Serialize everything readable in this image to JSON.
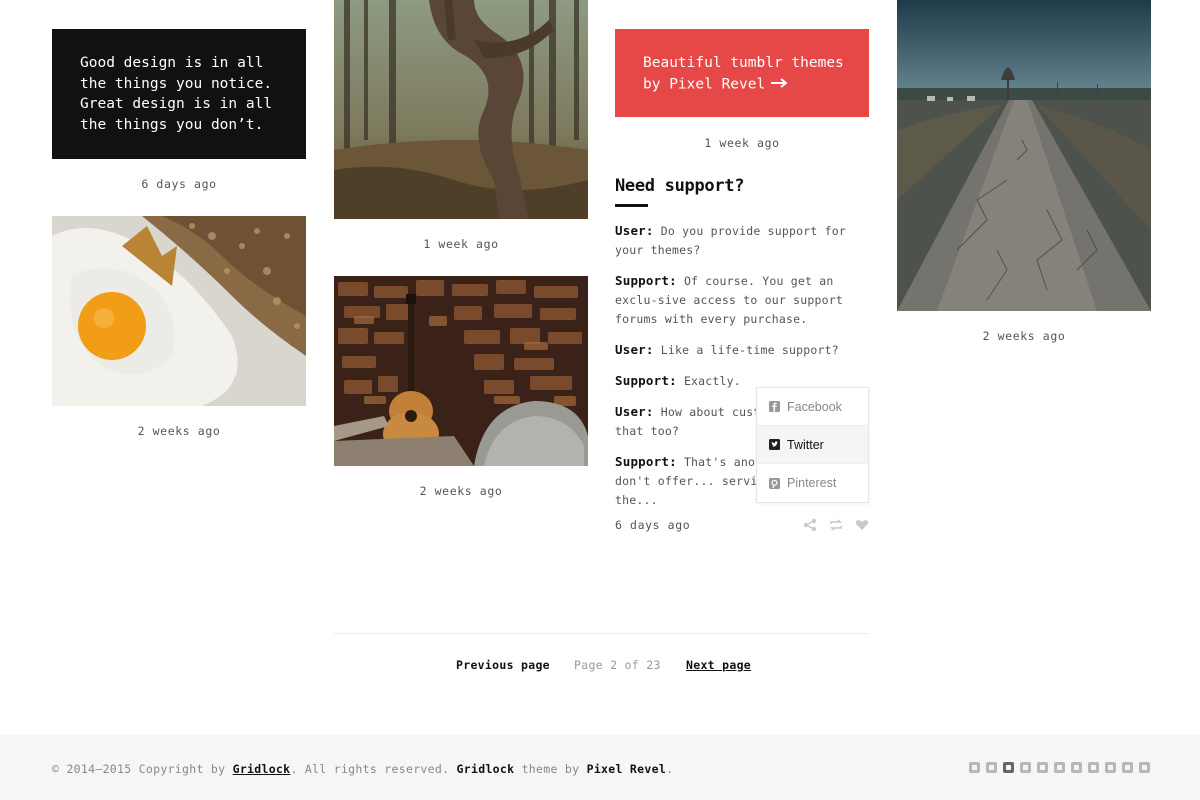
{
  "posts": {
    "quote": {
      "lines": [
        "Good design is in all",
        "the things you notice.",
        "Great design is in all",
        "the things you don’t."
      ],
      "time": "6 days ago"
    },
    "egg_photo": {
      "time": "2 weeks ago"
    },
    "forest_photo": {
      "time": "1 week ago"
    },
    "guitar_photo": {
      "time": "2 weeks ago"
    },
    "tumblr_link": {
      "lines": [
        "Beautiful tumblr themes",
        "by Pixel Revel"
      ],
      "time": "1 week ago"
    },
    "support": {
      "title": "Need support?",
      "chat": [
        {
          "who": "User:",
          "text": "Do you provide support for your themes?"
        },
        {
          "who": "Support:",
          "text": "Of course. You get an exclu-sive access to our support forums with every purchase."
        },
        {
          "who": "User:",
          "text": "Like a life-time support?"
        },
        {
          "who": "Support:",
          "text": "Exactly."
        },
        {
          "who": "User:",
          "text": "How about custo... you do that too?"
        },
        {
          "who": "Support:",
          "text": "That's anot... rently, we don't offer... services, maybe in the..."
        }
      ],
      "time": "6 days ago",
      "actions": [
        "share-icon",
        "reblog-icon",
        "heart-icon"
      ]
    },
    "road_photo": {
      "time": "2 weeks ago"
    }
  },
  "share_menu": {
    "items": [
      {
        "label": "Facebook",
        "icon": "facebook-icon"
      },
      {
        "label": "Twitter",
        "icon": "twitter-icon"
      },
      {
        "label": "Pinterest",
        "icon": "pinterest-icon"
      }
    ]
  },
  "pagination": {
    "prev": "Previous page",
    "info": "Page 2 of 23",
    "next": "Next page"
  },
  "footer": {
    "copyright_prefix": "© 2014–2015 Copyright by ",
    "copyright_owner": "Gridlock",
    "rights": ". All rights reserved. ",
    "theme_name": "Gridlock",
    "theme_by": " theme by ",
    "author": "Pixel Revel",
    "end": ".",
    "social_icons": [
      "facebook-icon",
      "twitter-icon",
      "instagram-icon",
      "flickr-icon",
      "tumblr-icon",
      "github-icon",
      "vimeo-icon",
      "dribbble-icon",
      "behance-icon",
      "skype-icon",
      "rss-icon"
    ]
  },
  "colors": {
    "accent": "#e54847",
    "dark_card": "#111111",
    "footer_bg": "#f6f6f6"
  }
}
